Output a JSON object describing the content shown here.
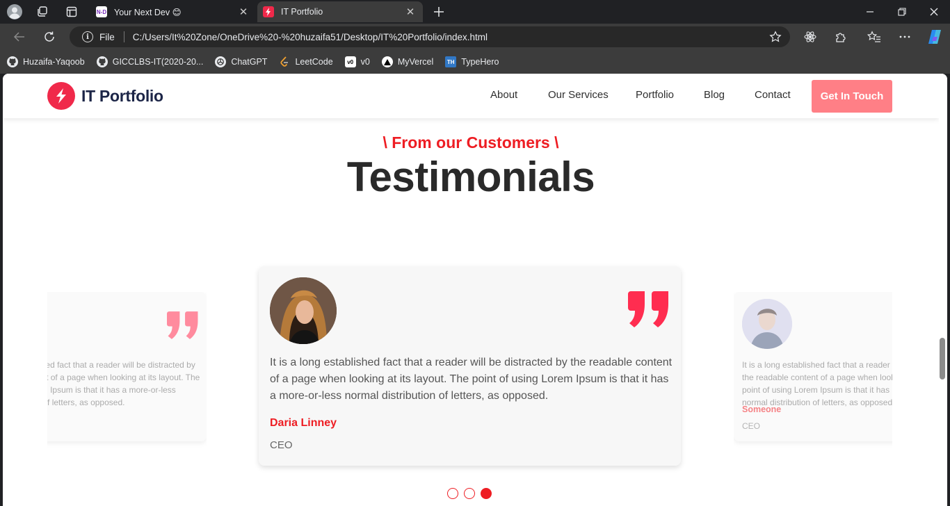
{
  "browser": {
    "tabs": [
      {
        "title": "Your Next Dev 😊",
        "active": false
      },
      {
        "title": "IT Portfolio",
        "active": true
      }
    ],
    "address": {
      "protocol_label": "File",
      "url": "C:/Users/It%20Zone/OneDrive%20-%20huzaifa51/Desktop/IT%20Portfolio/index.html"
    },
    "bookmarks": [
      {
        "label": "Huzaifa-Yaqoob",
        "icon": "github-icon"
      },
      {
        "label": "GICCLBS-IT(2020-20...",
        "icon": "github-icon"
      },
      {
        "label": "ChatGPT",
        "icon": "chatgpt-icon"
      },
      {
        "label": "LeetCode",
        "icon": "leetcode-icon"
      },
      {
        "label": "v0",
        "icon": "v0-icon"
      },
      {
        "label": "MyVercel",
        "icon": "vercel-icon"
      },
      {
        "label": "TypeHero",
        "icon": "typehero-icon",
        "icon_text": "TH"
      }
    ]
  },
  "site": {
    "brand": "IT Portfolio",
    "nav": [
      "About",
      "Our Services",
      "Portfolio",
      "Blog",
      "Contact"
    ],
    "cta": "Get In Touch",
    "accent_color": "#ee1d23",
    "cta_color": "#ff7f86"
  },
  "testimonials": {
    "kicker": "\\ From our Customers \\",
    "heading": "Testimonials",
    "cards": [
      {
        "position": "left",
        "text": "It is a long established fact that a reader will be distracted by the readable content of a page when looking at its layout. The point of using Lorem Ipsum is that it has a more-or-less normal distribution of letters, as opposed."
      },
      {
        "position": "center",
        "text": "It is a long established fact that a reader will be distracted by the readable content of a page when looking at its layout. The point of using Lorem Ipsum is that it has a more-or-less normal distribution of letters, as opposed.",
        "author": "Daria Linney",
        "role": "CEO"
      },
      {
        "position": "right",
        "text": "It is a long established fact that a reader will be distracted by the readable content of a page when looking at its layout. The point of using Lorem Ipsum is that it has a more-or-less normal distribution of letters, as opposed.",
        "author": "Someone",
        "role": "CEO"
      }
    ],
    "pagination": {
      "count": 3,
      "active_index": 2
    }
  }
}
